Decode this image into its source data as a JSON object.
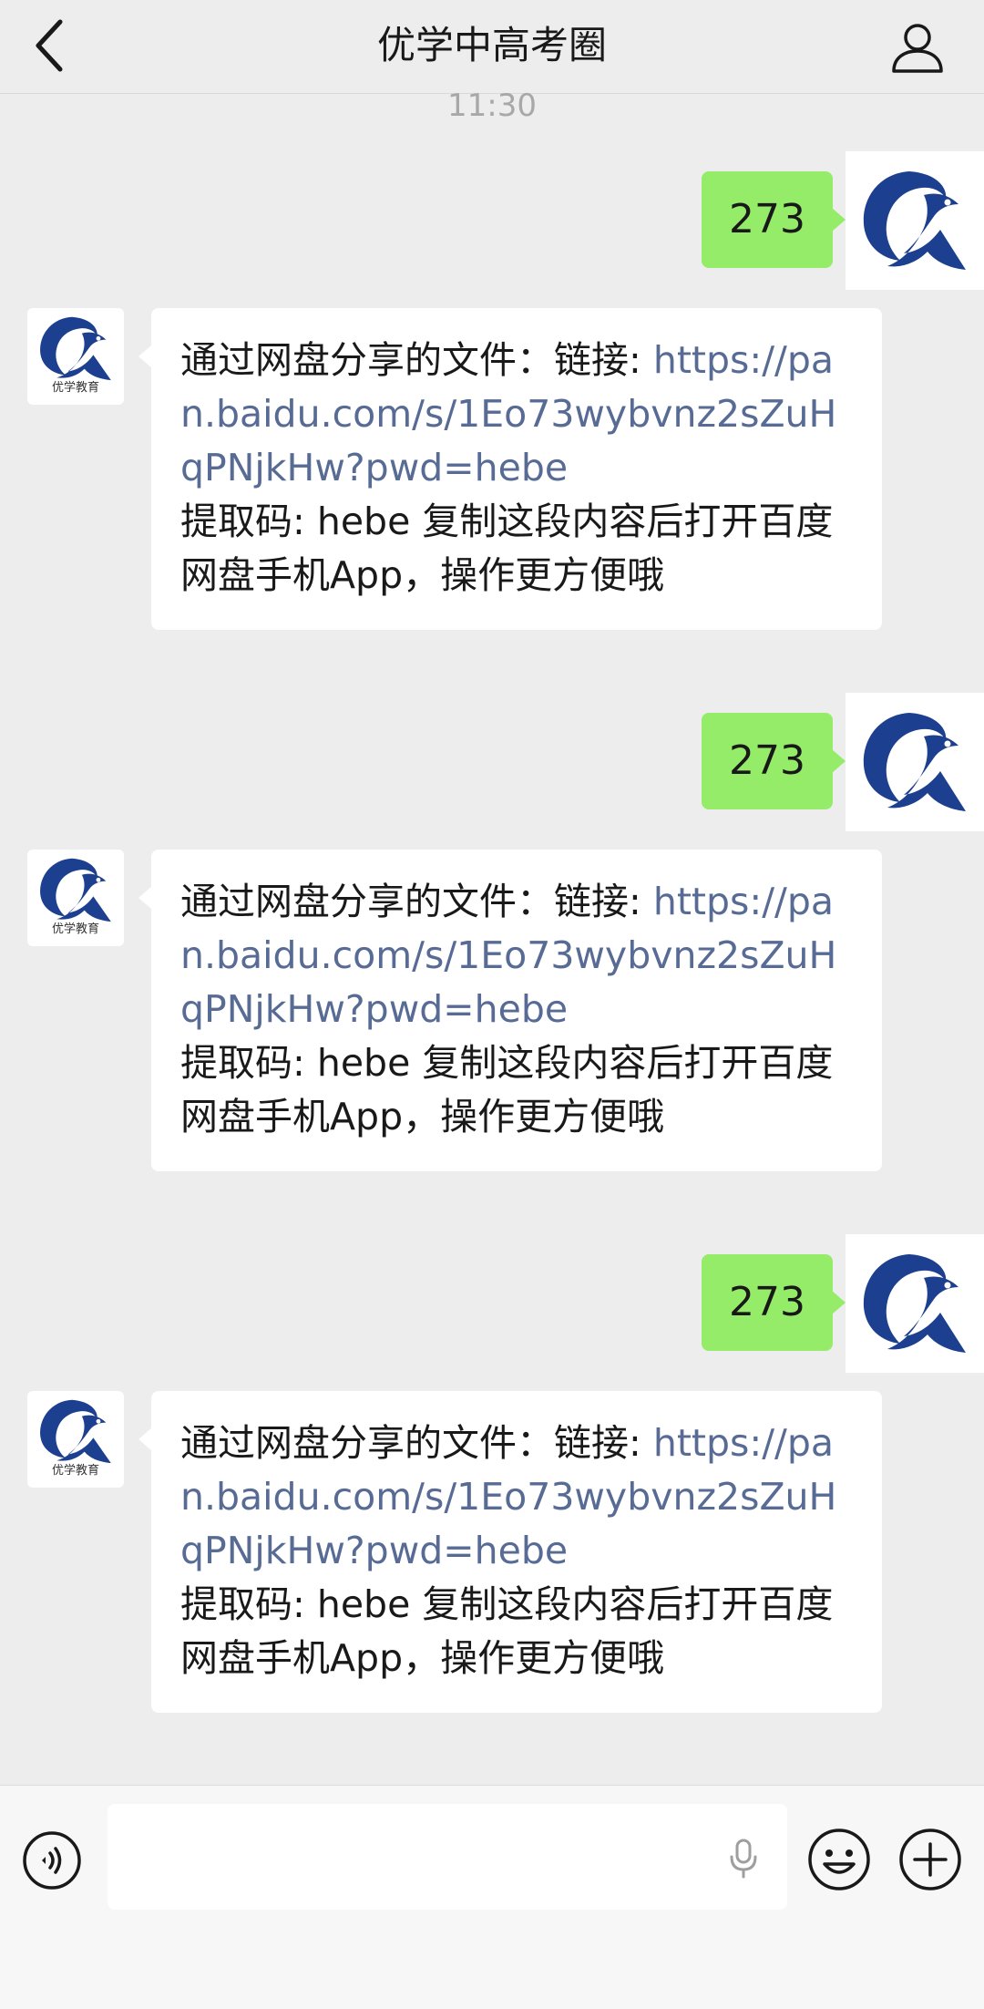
{
  "header": {
    "title": "优学中高考圈",
    "back_icon": "chevron-left-icon",
    "profile_icon": "user-icon"
  },
  "timestamp": "11:30",
  "messages": [
    {
      "from": "me",
      "text": "273"
    },
    {
      "from": "other",
      "prefix": "通过网盘分享的文件：链接: ",
      "link": "https://pan.baidu.com/s/1Eo73wybvnz2sZuHqPNjkHw?pwd=hebe",
      "suffix": "提取码: hebe 复制这段内容后打开百度网盘手机App，操作更方便哦"
    },
    {
      "from": "me",
      "text": "273"
    },
    {
      "from": "other",
      "prefix": "通过网盘分享的文件：链接: ",
      "link": "https://pan.baidu.com/s/1Eo73wybvnz2sZuHqPNjkHw?pwd=hebe",
      "suffix": "提取码: hebe 复制这段内容后打开百度网盘手机App，操作更方便哦"
    },
    {
      "from": "me",
      "text": "273"
    },
    {
      "from": "other",
      "prefix": "通过网盘分享的文件：链接: ",
      "link": "https://pan.baidu.com/s/1Eo73wybvnz2sZuHqPNjkHw?pwd=hebe",
      "suffix": "提取码: hebe 复制这段内容后打开百度网盘手机App，操作更方便哦"
    }
  ],
  "avatar": {
    "caption": "优学教育",
    "brand_color": "#1d3f8f"
  },
  "input_bar": {
    "voice_icon": "voice-icon",
    "mic_icon": "microphone-icon",
    "emoji_icon": "emoji-icon",
    "plus_icon": "plus-icon"
  },
  "colors": {
    "background": "#ededed",
    "sent_bubble": "#95ec69",
    "link": "#576b95"
  }
}
